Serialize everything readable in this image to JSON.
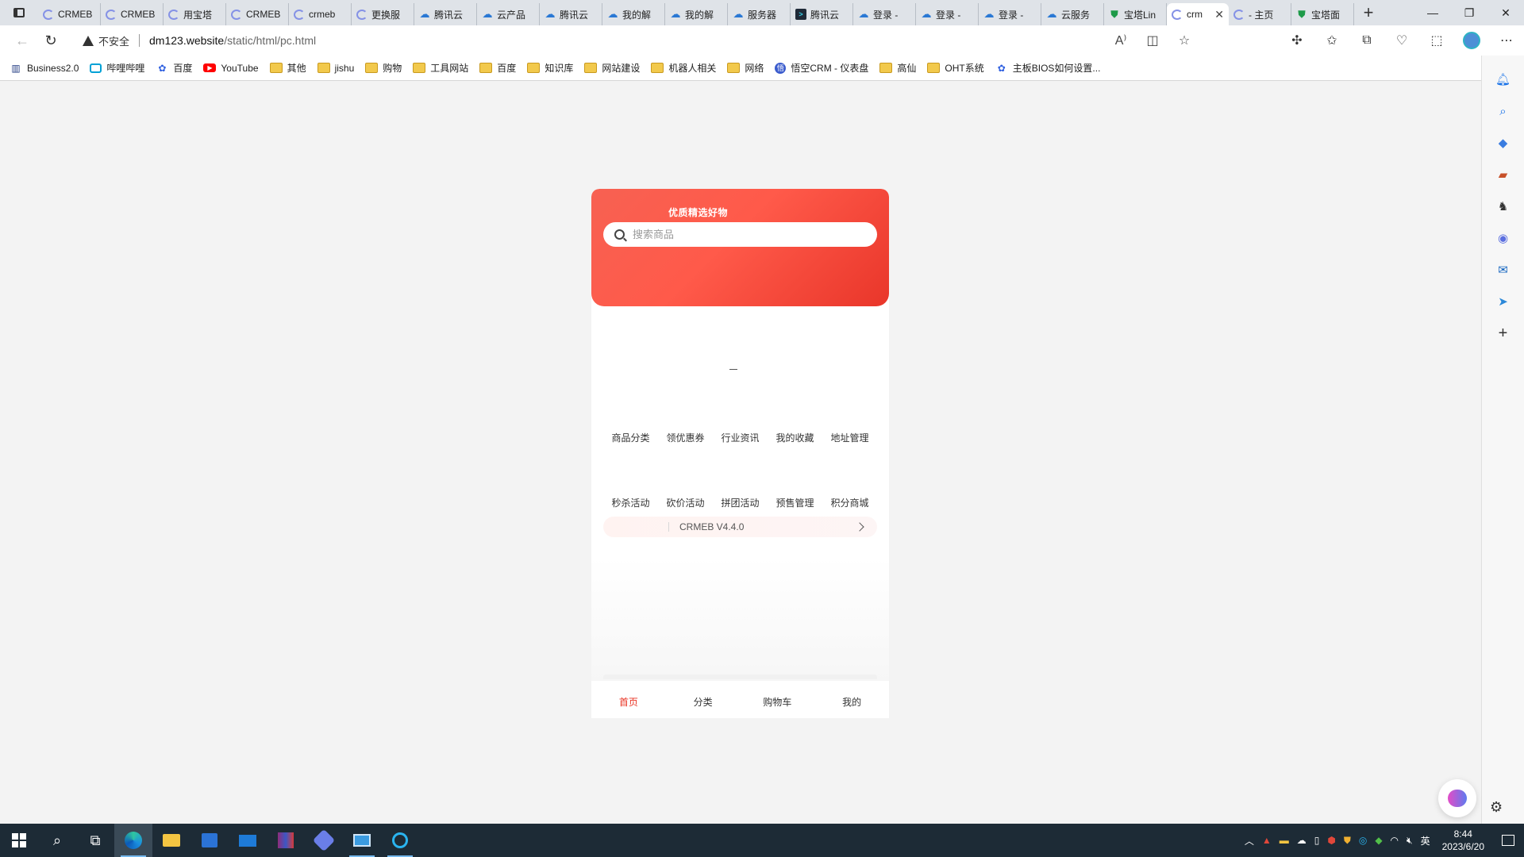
{
  "browser": {
    "tabs": [
      {
        "label": "CRMEB",
        "icon": "crmeb"
      },
      {
        "label": "CRMEB",
        "icon": "crmeb"
      },
      {
        "label": "用宝塔",
        "icon": "crmeb"
      },
      {
        "label": "CRMEB",
        "icon": "crmeb"
      },
      {
        "label": "crmeb",
        "icon": "crmeb"
      },
      {
        "label": "更换服",
        "icon": "crmeb"
      },
      {
        "label": "腾讯云",
        "icon": "cloud"
      },
      {
        "label": "云产品",
        "icon": "cloud"
      },
      {
        "label": "腾讯云",
        "icon": "cloud"
      },
      {
        "label": "我的解",
        "icon": "cloud"
      },
      {
        "label": "我的解",
        "icon": "cloud"
      },
      {
        "label": "服务器",
        "icon": "cloud"
      },
      {
        "label": "腾讯云",
        "icon": "term"
      },
      {
        "label": "登录 -",
        "icon": "cloud"
      },
      {
        "label": "登录 -",
        "icon": "cloud"
      },
      {
        "label": "登录 -",
        "icon": "cloud"
      },
      {
        "label": "云服务",
        "icon": "cloud"
      },
      {
        "label": "宝塔Lin",
        "icon": "shield"
      },
      {
        "label": "crm",
        "icon": "crmeb",
        "active": true
      },
      {
        "label": "- 主页",
        "icon": "crmeb"
      },
      {
        "label": "宝塔面",
        "icon": "shield"
      }
    ],
    "address": {
      "security_label": "不安全",
      "host": "dm123.website",
      "path": "/static/html/pc.html"
    },
    "bookmarks": [
      {
        "label": "Business2.0",
        "icon": "biz"
      },
      {
        "label": "哔哩哔哩",
        "icon": "bili"
      },
      {
        "label": "百度",
        "icon": "baidu"
      },
      {
        "label": "YouTube",
        "icon": "yt"
      },
      {
        "label": "其他",
        "icon": "folder"
      },
      {
        "label": "jishu",
        "icon": "folder"
      },
      {
        "label": "购物",
        "icon": "folder"
      },
      {
        "label": "工具网站",
        "icon": "folder"
      },
      {
        "label": "百度",
        "icon": "folder"
      },
      {
        "label": "知识库",
        "icon": "folder"
      },
      {
        "label": "网站建设",
        "icon": "folder"
      },
      {
        "label": "机器人相关",
        "icon": "folder"
      },
      {
        "label": "网络",
        "icon": "folder"
      },
      {
        "label": "悟空CRM - 仪表盘",
        "icon": "wk"
      },
      {
        "label": "高仙",
        "icon": "folder"
      },
      {
        "label": "OHT系统",
        "icon": "folder"
      },
      {
        "label": "主板BIOS如何设置...",
        "icon": "baidu"
      }
    ]
  },
  "mobile_page": {
    "slogan": "优质精选好物",
    "search_placeholder": "搜索商品",
    "nav_items": [
      "商品分类",
      "领优惠券",
      "行业资讯",
      "我的收藏",
      "地址管理",
      "秒杀活动",
      "砍价活动",
      "拼团活动",
      "预售管理",
      "积分商城"
    ],
    "news_text": "CRMEB V4.4.0",
    "tabbar": [
      "首页",
      "分类",
      "购物车",
      "我的"
    ],
    "active_tab": 0,
    "accent_color": "#e93323"
  },
  "taskbar": {
    "ime_label": "英",
    "time": "8:44",
    "date": "2023/6/20"
  }
}
